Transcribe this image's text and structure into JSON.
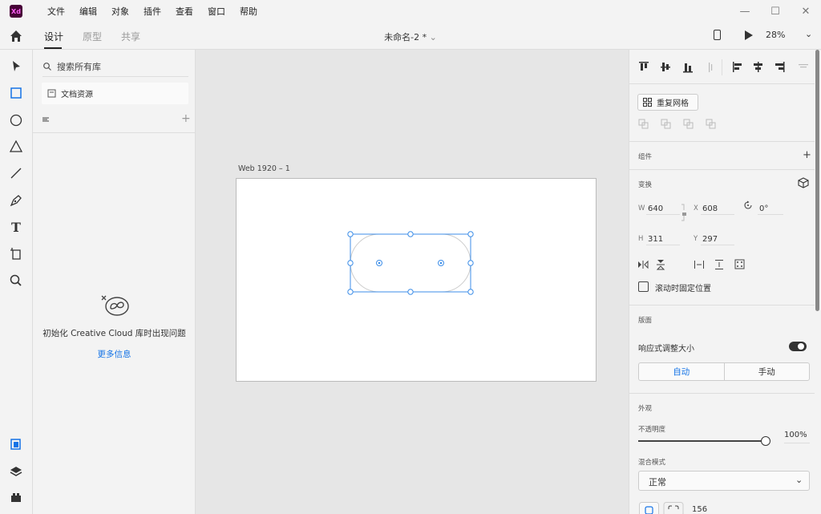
{
  "app": {
    "logo": "Xd",
    "menus": [
      "文件",
      "编辑",
      "对象",
      "插件",
      "查看",
      "窗口",
      "帮助"
    ],
    "window_controls": [
      "—",
      "☐",
      "✕"
    ]
  },
  "topbar": {
    "tabs": [
      "设计",
      "原型",
      "共享"
    ],
    "doc_title": "未命名-2 *",
    "zoom": "28%"
  },
  "library": {
    "search_placeholder": "搜索所有库",
    "document_assets": "文档资源",
    "add": "+",
    "error_message": "初始化 Creative Cloud 库时出现问题",
    "more_info": "更多信息"
  },
  "canvas": {
    "artboard_name": "Web 1920 – 1"
  },
  "inspector": {
    "repeat_grid": "重复网格",
    "component_title": "组件",
    "component_add": "+",
    "transform_title": "变换",
    "w_label": "W",
    "w_value": "640",
    "x_label": "X",
    "x_value": "608",
    "rotation_value": "0°",
    "h_label": "H",
    "h_value": "311",
    "y_label": "Y",
    "y_value": "297",
    "fix_position": "滚动时固定位置",
    "layout_title": "版面",
    "responsive_resize": "响应式调整大小",
    "responsive_on": true,
    "seg_auto": "自动",
    "seg_manual": "手动",
    "appearance_title": "外观",
    "opacity_label": "不透明度",
    "opacity_value": "100%",
    "opacity_fraction": 1.0,
    "blend_label": "混合模式",
    "blend_value": "正常",
    "corner_value": "156"
  },
  "colors": {
    "accent": "#1473e6",
    "selection": "#3d8ee8",
    "logo_bg": "#470137",
    "logo_fg": "#ff61f6"
  }
}
